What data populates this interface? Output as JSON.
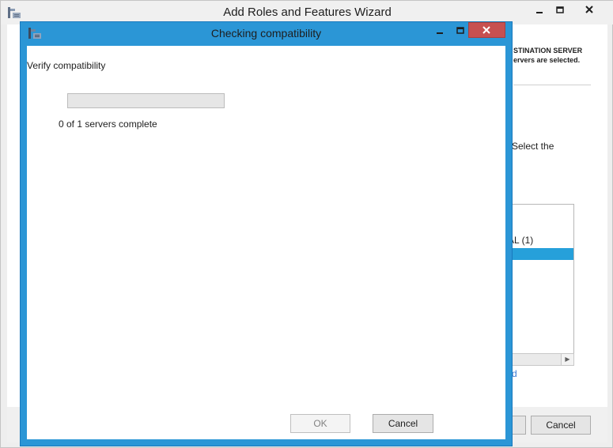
{
  "background_window": {
    "title": "Add Roles and Features Wizard",
    "destination_server_label": "STINATION SERVER",
    "servers_selected_text": "ervers are selected.",
    "select_the_text": "Select the",
    "list_item_partial": "AL (1)",
    "link_partial": "d",
    "cancel_label": "Cancel",
    "icons": [
      "wizard-app-icon",
      "minimize-icon",
      "maximize-icon",
      "close-icon"
    ]
  },
  "dialog": {
    "title": "Checking compatibility",
    "heading": "Verify compatibility",
    "progress": {
      "completed": 0,
      "total": 1,
      "fraction": 0.0
    },
    "progress_text": "0 of 1 servers complete",
    "ok_label": "OK",
    "cancel_label": "Cancel",
    "ok_enabled": false,
    "icons": [
      "dialog-app-icon",
      "minimize-icon",
      "maximize-icon",
      "close-icon"
    ]
  },
  "colors": {
    "dialog_frame": "#2b96d6",
    "close_button": "#c75050",
    "selection": "#26a0da",
    "link": "#3a7bd5"
  }
}
